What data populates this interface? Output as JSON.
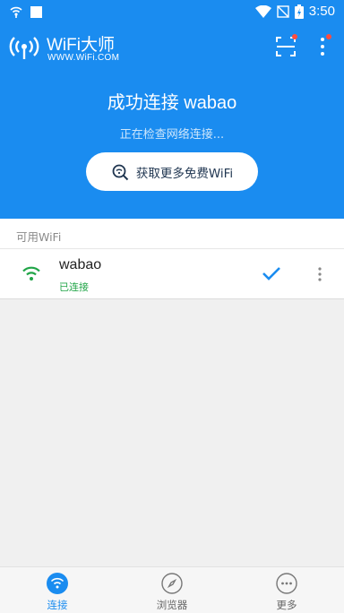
{
  "status_bar": {
    "time": "3:50",
    "icons": [
      "wifi-signal-icon",
      "notification-square-icon",
      "wifi-icon",
      "no-sim-icon",
      "battery-charging-icon"
    ]
  },
  "app_bar": {
    "title": "WiFi大师",
    "subtitle": "WWW.WiFi.COM",
    "icons": [
      "app-logo-icon",
      "scan-icon",
      "more-vertical-icon"
    ]
  },
  "connection": {
    "title": "成功连接 wabao",
    "status": "正在检查网络连接...",
    "more_button": "获取更多免费WiFi"
  },
  "wifi_section": {
    "header": "可用WiFi",
    "networks": [
      {
        "ssid": "wabao",
        "status": "已连接",
        "icon": "wifi-signal-icon",
        "connected": true
      }
    ]
  },
  "bottom_nav": {
    "items": [
      {
        "label": "连接",
        "icon": "wifi-icon",
        "active": true
      },
      {
        "label": "浏览器",
        "icon": "compass-icon",
        "active": false
      },
      {
        "label": "更多",
        "icon": "more-horizontal-icon",
        "active": false
      }
    ]
  },
  "colors": {
    "primary": "#1a8cf0",
    "connected_green": "#21a548",
    "badge_red": "#ff4b3e"
  }
}
